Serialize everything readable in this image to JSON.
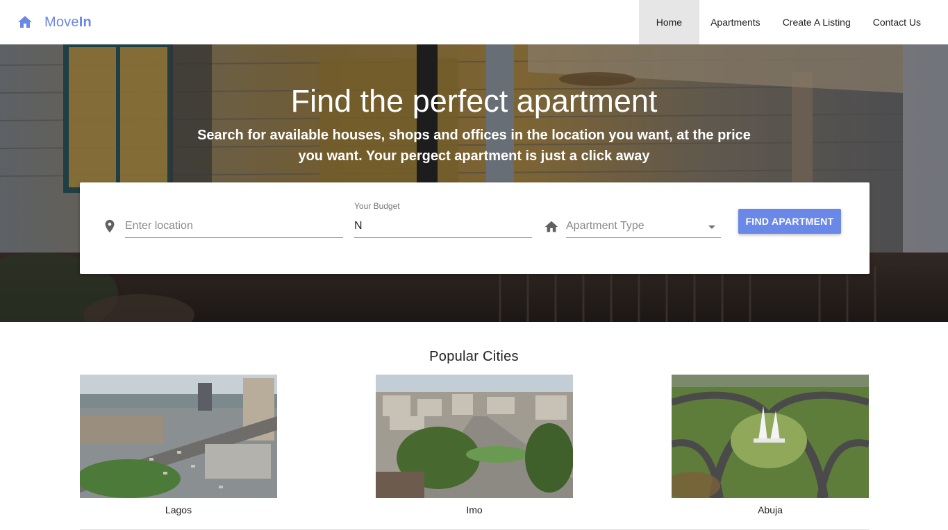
{
  "brand": {
    "name_light": "Move",
    "name_bold": "In",
    "icon": "home-icon",
    "color": "#6a88e8"
  },
  "nav": {
    "items": [
      "Home",
      "Apartments",
      "Create A Listing",
      "Contact Us"
    ],
    "active": "Home"
  },
  "hero": {
    "title": "Find the perfect apartment",
    "subtitle": "Search for available houses, shops and offices in the location you want, at the price you want. Your pergect apartment is just a click away"
  },
  "search": {
    "location_placeholder": "Enter location",
    "location_icon": "map-pin-icon",
    "budget_label": "Your Budget",
    "budget_value": "N",
    "type_placeholder": "Apartment Type",
    "type_icon": "home-icon",
    "button_label": "FIND APARTMENT"
  },
  "popular": {
    "title": "Popular Cities",
    "cities": [
      "Lagos",
      "Imo",
      "Abuja"
    ]
  }
}
